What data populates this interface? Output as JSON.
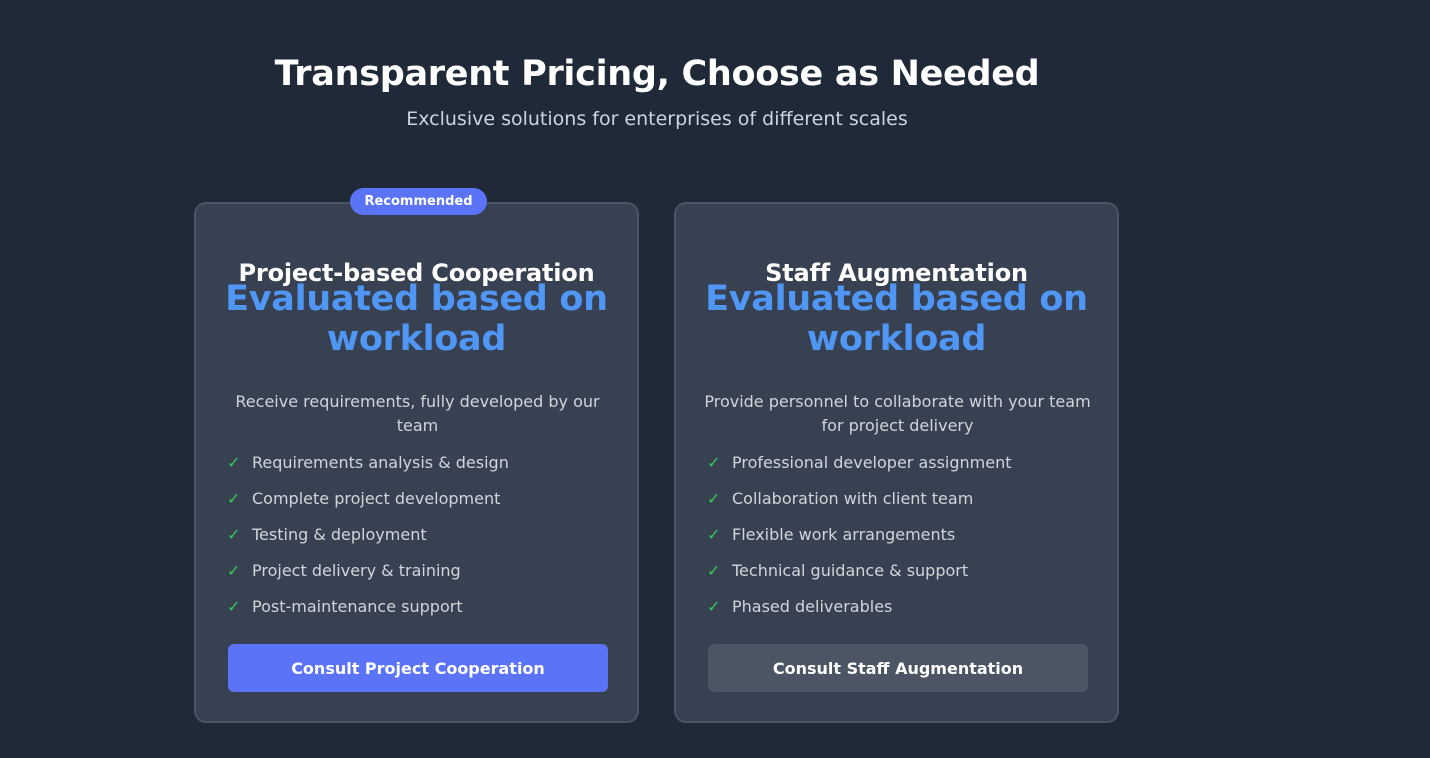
{
  "header": {
    "title": "Transparent Pricing, Choose as Needed",
    "subtitle": "Exclusive solutions for enterprises of different scales"
  },
  "plans": [
    {
      "badge": "Recommended",
      "title": "Project-based Cooperation",
      "price_line_1": "Evaluated based on",
      "price_line_2": "workload",
      "description": "Receive requirements, fully developed by our team",
      "features": [
        "Requirements analysis & design",
        "Complete project development",
        "Testing & deployment",
        "Project delivery & training",
        "Post-maintenance support"
      ],
      "button_label": "Consult Project Cooperation"
    },
    {
      "title": "Staff Augmentation",
      "price_line_1": "Evaluated based on",
      "price_line_2": "workload",
      "description": "Provide personnel to collaborate with your team for project delivery",
      "features": [
        "Professional developer assignment",
        "Collaboration with client team",
        "Flexible work arrangements",
        "Technical guidance & support",
        "Phased deliverables"
      ],
      "button_label": "Consult Staff Augmentation"
    }
  ],
  "icons": {
    "check": "check-icon"
  },
  "colors": {
    "background": "#1f2937",
    "card": "#374151",
    "accent": "#5b74f7",
    "price": "#4f96f5",
    "check": "#34c759"
  }
}
